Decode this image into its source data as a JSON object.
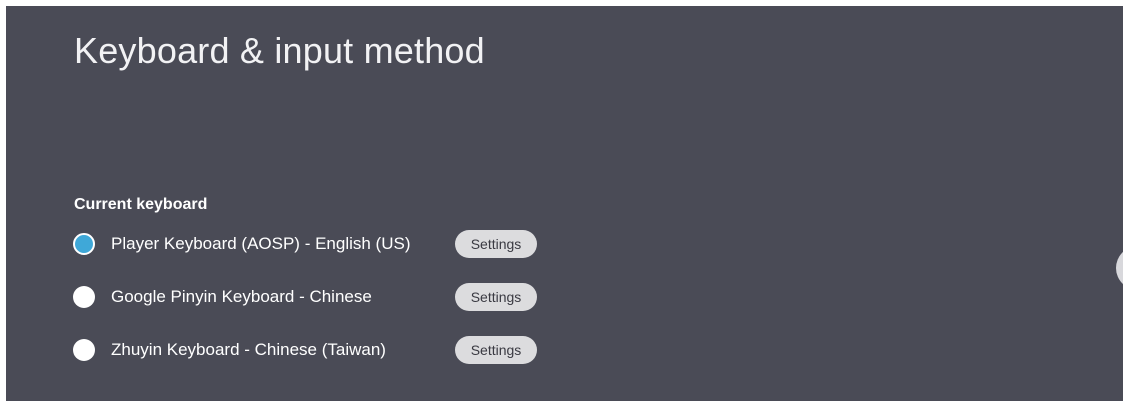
{
  "page": {
    "title": "Keyboard & input method"
  },
  "current_keyboard": {
    "header": "Current keyboard",
    "items": [
      {
        "label": "Player Keyboard (AOSP) - English (US)",
        "selected": true,
        "settings_label": "Settings"
      },
      {
        "label": "Google Pinyin Keyboard - Chinese",
        "selected": false,
        "settings_label": "Settings"
      },
      {
        "label": "Zhuyin Keyboard - Chinese (Taiwan)",
        "selected": false,
        "settings_label": "Settings"
      }
    ]
  },
  "colors": {
    "background": "#4a4b56",
    "radio_selected": "#3fa8d8",
    "button_bg": "#dcdcde"
  }
}
